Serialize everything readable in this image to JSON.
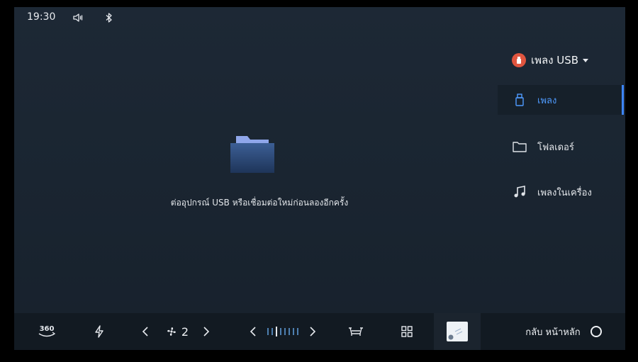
{
  "status": {
    "time": "19:30"
  },
  "main": {
    "empty_message": "ต่ออุปกรณ์ USB หรือเชื่อมต่อใหม่ก่อนลองอีกครั้ง"
  },
  "source": {
    "label": "เพลง USB",
    "icon": "usb-icon",
    "accent": "#e0553f"
  },
  "nav": {
    "items": [
      {
        "label": "เพลง",
        "icon": "usb-drive-icon",
        "active": true
      },
      {
        "label": "โฟลเดอร์",
        "icon": "folder-icon",
        "active": false
      },
      {
        "label": "เพลงในเครื่อง",
        "icon": "music-note-icon",
        "active": false
      }
    ],
    "active_color": "#4f9bff"
  },
  "bottom": {
    "view360_label": "360",
    "fan_level": "2",
    "home_label": "กลับ หน้าหลัก"
  }
}
